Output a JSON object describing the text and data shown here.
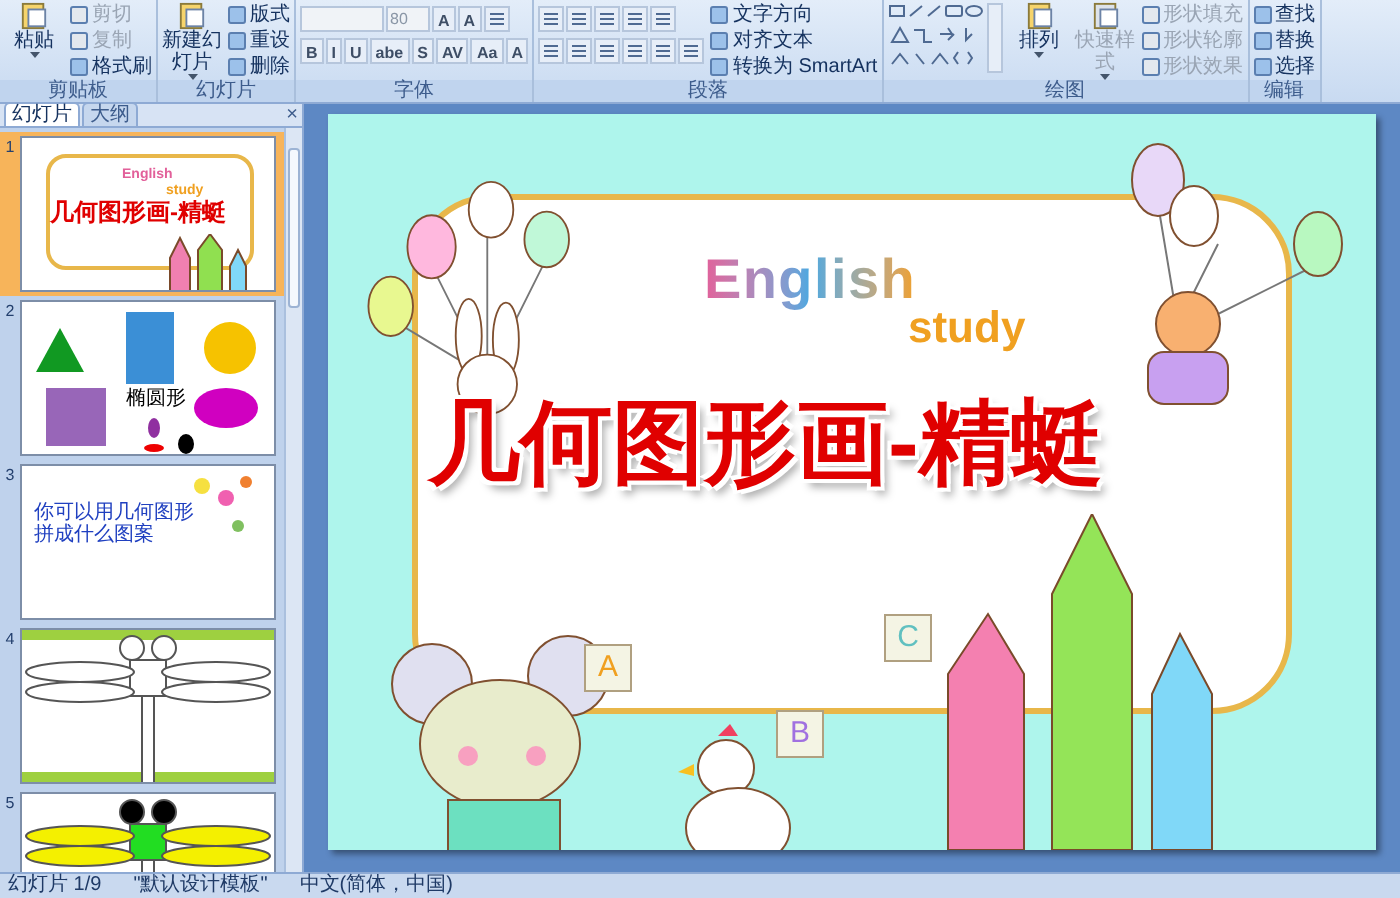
{
  "ribbon": {
    "groups": [
      {
        "label": "剪贴板",
        "items": [
          {
            "kind": "large",
            "label": "粘贴",
            "disabled": false,
            "dropdown": true
          },
          {
            "kind": "column",
            "items": [
              {
                "label": "剪切",
                "disabled": true
              },
              {
                "label": "复制",
                "disabled": true
              },
              {
                "label": "格式刷",
                "disabled": false
              }
            ]
          }
        ]
      },
      {
        "label": "幻灯片",
        "items": [
          {
            "kind": "large",
            "label": "新建幻灯片",
            "disabled": false,
            "dropdown": true
          },
          {
            "kind": "column",
            "items": [
              {
                "label": "版式",
                "disabled": false
              },
              {
                "label": "重设",
                "disabled": false
              },
              {
                "label": "删除",
                "disabled": false
              }
            ]
          }
        ]
      },
      {
        "label": "字体",
        "items": [
          {
            "kind": "toolbars",
            "toolbars": [
              {
                "controls": [
                  {
                    "kind": "field"
                  },
                  {
                    "kind": "select",
                    "value": "80"
                  },
                  {
                    "kind": "glyph",
                    "label": "A"
                  },
                  {
                    "kind": "glyph",
                    "label": "A"
                  },
                  {
                    "kind": "icon"
                  }
                ]
              },
              {
                "controls": [
                  {
                    "kind": "glyph",
                    "label": "B"
                  },
                  {
                    "kind": "glyph",
                    "label": "I"
                  },
                  {
                    "kind": "glyph",
                    "label": "U"
                  },
                  {
                    "kind": "glyph",
                    "label": "abe"
                  },
                  {
                    "kind": "glyph",
                    "label": "S"
                  },
                  {
                    "kind": "glyph",
                    "label": "AV"
                  },
                  {
                    "kind": "glyph",
                    "label": "Aa"
                  },
                  {
                    "kind": "glyph",
                    "label": "A"
                  }
                ]
              }
            ]
          }
        ]
      },
      {
        "label": "段落",
        "items": [
          {
            "kind": "toolbars",
            "toolbars": [
              {
                "controls": [
                  {
                    "kind": "icon"
                  },
                  {
                    "kind": "icon"
                  },
                  {
                    "kind": "icon"
                  },
                  {
                    "kind": "icon"
                  },
                  {
                    "kind": "icon"
                  }
                ]
              },
              {
                "controls": [
                  {
                    "kind": "icon"
                  },
                  {
                    "kind": "icon"
                  },
                  {
                    "kind": "icon"
                  },
                  {
                    "kind": "icon"
                  },
                  {
                    "kind": "icon"
                  },
                  {
                    "kind": "icon"
                  }
                ]
              }
            ]
          },
          {
            "kind": "column",
            "items": [
              {
                "label": "文字方向",
                "disabled": false
              },
              {
                "label": "对齐文本",
                "disabled": false
              },
              {
                "label": "转换为 SmartArt",
                "disabled": false
              }
            ]
          }
        ]
      },
      {
        "label": "绘图",
        "items": [
          {
            "kind": "gallery"
          },
          {
            "kind": "large",
            "label": "排列",
            "disabled": false,
            "dropdown": true
          },
          {
            "kind": "large",
            "label": "快速样式",
            "disabled": true,
            "dropdown": true
          },
          {
            "kind": "column",
            "items": [
              {
                "label": "形状填充",
                "disabled": true
              },
              {
                "label": "形状轮廓",
                "disabled": true
              },
              {
                "label": "形状效果",
                "disabled": true
              }
            ]
          }
        ]
      },
      {
        "label": "编辑",
        "items": [
          {
            "kind": "column",
            "items": [
              {
                "label": "查找",
                "disabled": false
              },
              {
                "label": "替换",
                "disabled": false
              },
              {
                "label": "选择",
                "disabled": false
              }
            ]
          }
        ]
      }
    ]
  },
  "panel": {
    "tabs": [
      {
        "label": "幻灯片",
        "selected": true
      },
      {
        "label": "大纲",
        "selected": false
      }
    ],
    "close": "×",
    "slides": [
      {
        "number": "1",
        "selected": true,
        "kind": "title",
        "english": "English",
        "study": "study",
        "title": "几何图形画-精蜓"
      },
      {
        "number": "2",
        "selected": false,
        "kind": "shapes",
        "caption": "椭圆形"
      },
      {
        "number": "3",
        "selected": false,
        "kind": "text",
        "text": "你可以用几何图形拼成什么图案"
      },
      {
        "number": "4",
        "selected": false,
        "kind": "dragonfly"
      },
      {
        "number": "5",
        "selected": false,
        "kind": "dragonfly-color"
      }
    ]
  },
  "slide": {
    "english": "English",
    "study": "study",
    "title": "几何图形画-精蜓",
    "blocks": [
      "A",
      "B",
      "C"
    ]
  },
  "status_bar": [
    "幻灯片 1/9",
    "\"默认设计模板\"",
    "中文(简体，中国)"
  ]
}
